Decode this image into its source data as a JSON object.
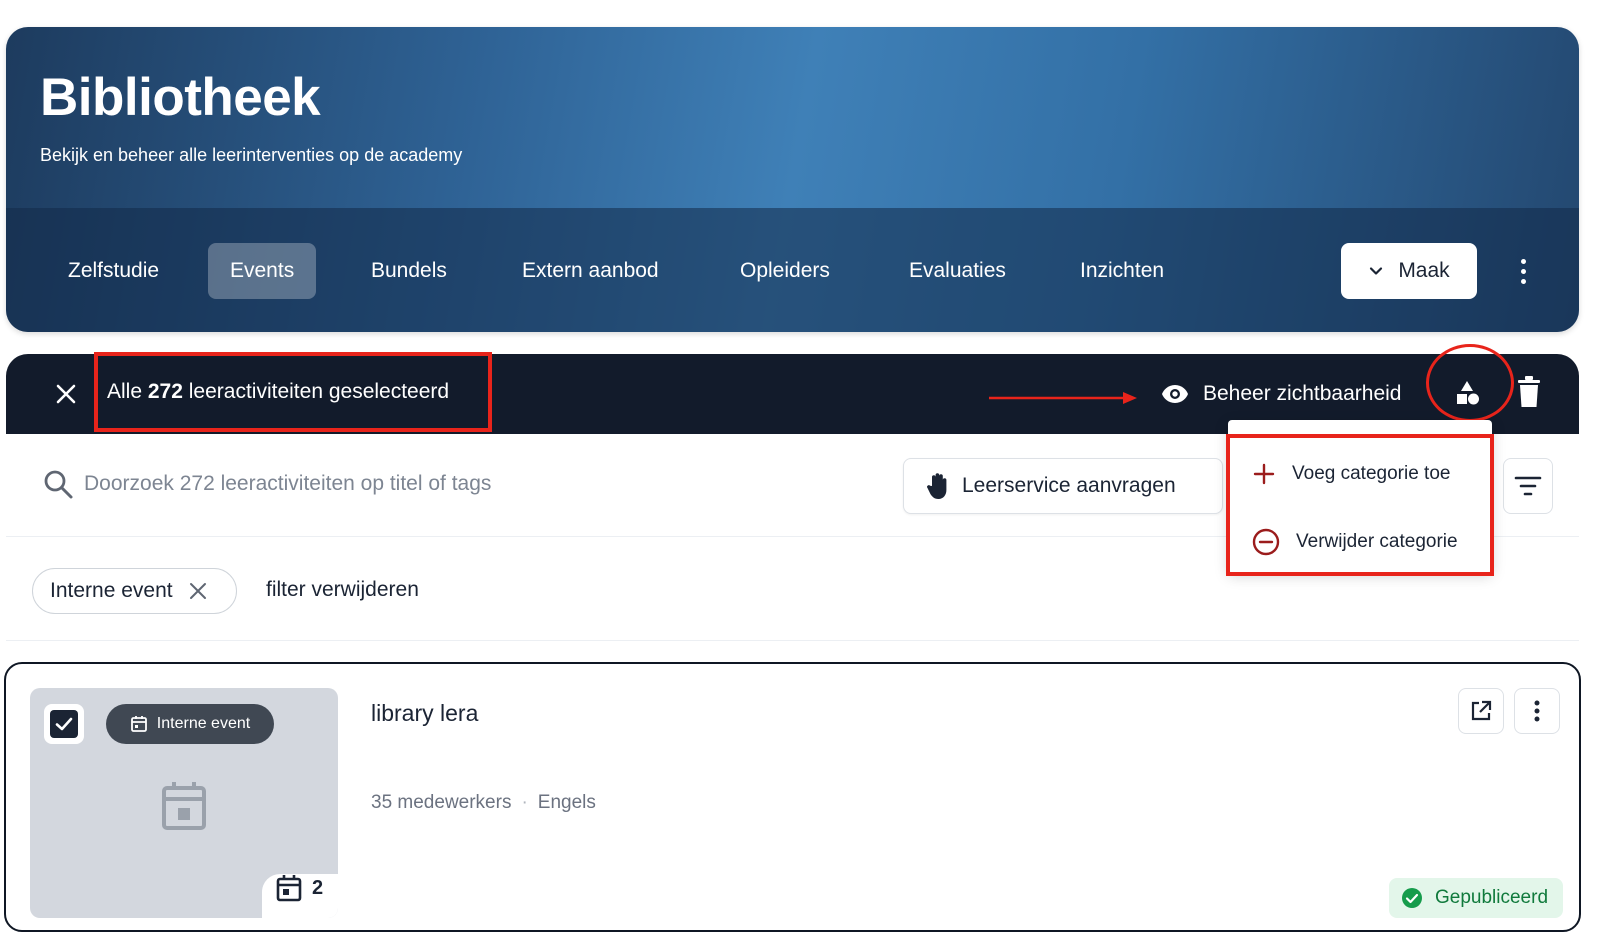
{
  "header": {
    "title": "Bibliotheek",
    "subtitle": "Bekijk en beheer alle leerinterventies op de academy",
    "tabs": [
      {
        "label": "Zelfstudie"
      },
      {
        "label": "Events"
      },
      {
        "label": "Bundels"
      },
      {
        "label": "Extern aanbod"
      },
      {
        "label": "Opleiders"
      },
      {
        "label": "Evaluaties"
      },
      {
        "label": "Inzichten"
      }
    ],
    "active_tab": "Events",
    "create_label": "Maak"
  },
  "selection": {
    "prefix": "Alle",
    "count": "272",
    "suffix": "leeractiviteiten geselecteerd",
    "visibility_label": "Beheer zichtbaarheid"
  },
  "category_menu": {
    "items": [
      {
        "label": "Voeg categorie toe",
        "icon": "plus-icon"
      },
      {
        "label": "Verwijder categorie",
        "icon": "minus-circle-icon"
      }
    ]
  },
  "search": {
    "placeholder": "Doorzoek 272 leeractiviteiten op titel of tags",
    "value": ""
  },
  "request_button": {
    "label": "Leerservice aanvragen"
  },
  "filters": {
    "chips": [
      {
        "label": "Interne event"
      }
    ],
    "clear_label": "filter verwijderen"
  },
  "items": [
    {
      "type": "Interne event",
      "title": "library lera",
      "employees": "35 medewerkers",
      "separator": "·",
      "language": "Engels",
      "sessions": "2",
      "status": "Gepubliceerd",
      "selected": true
    }
  ],
  "colors": {
    "accent_red": "#e8241b",
    "selection_bar": "#121b2b",
    "status_green": "#107a3c"
  }
}
